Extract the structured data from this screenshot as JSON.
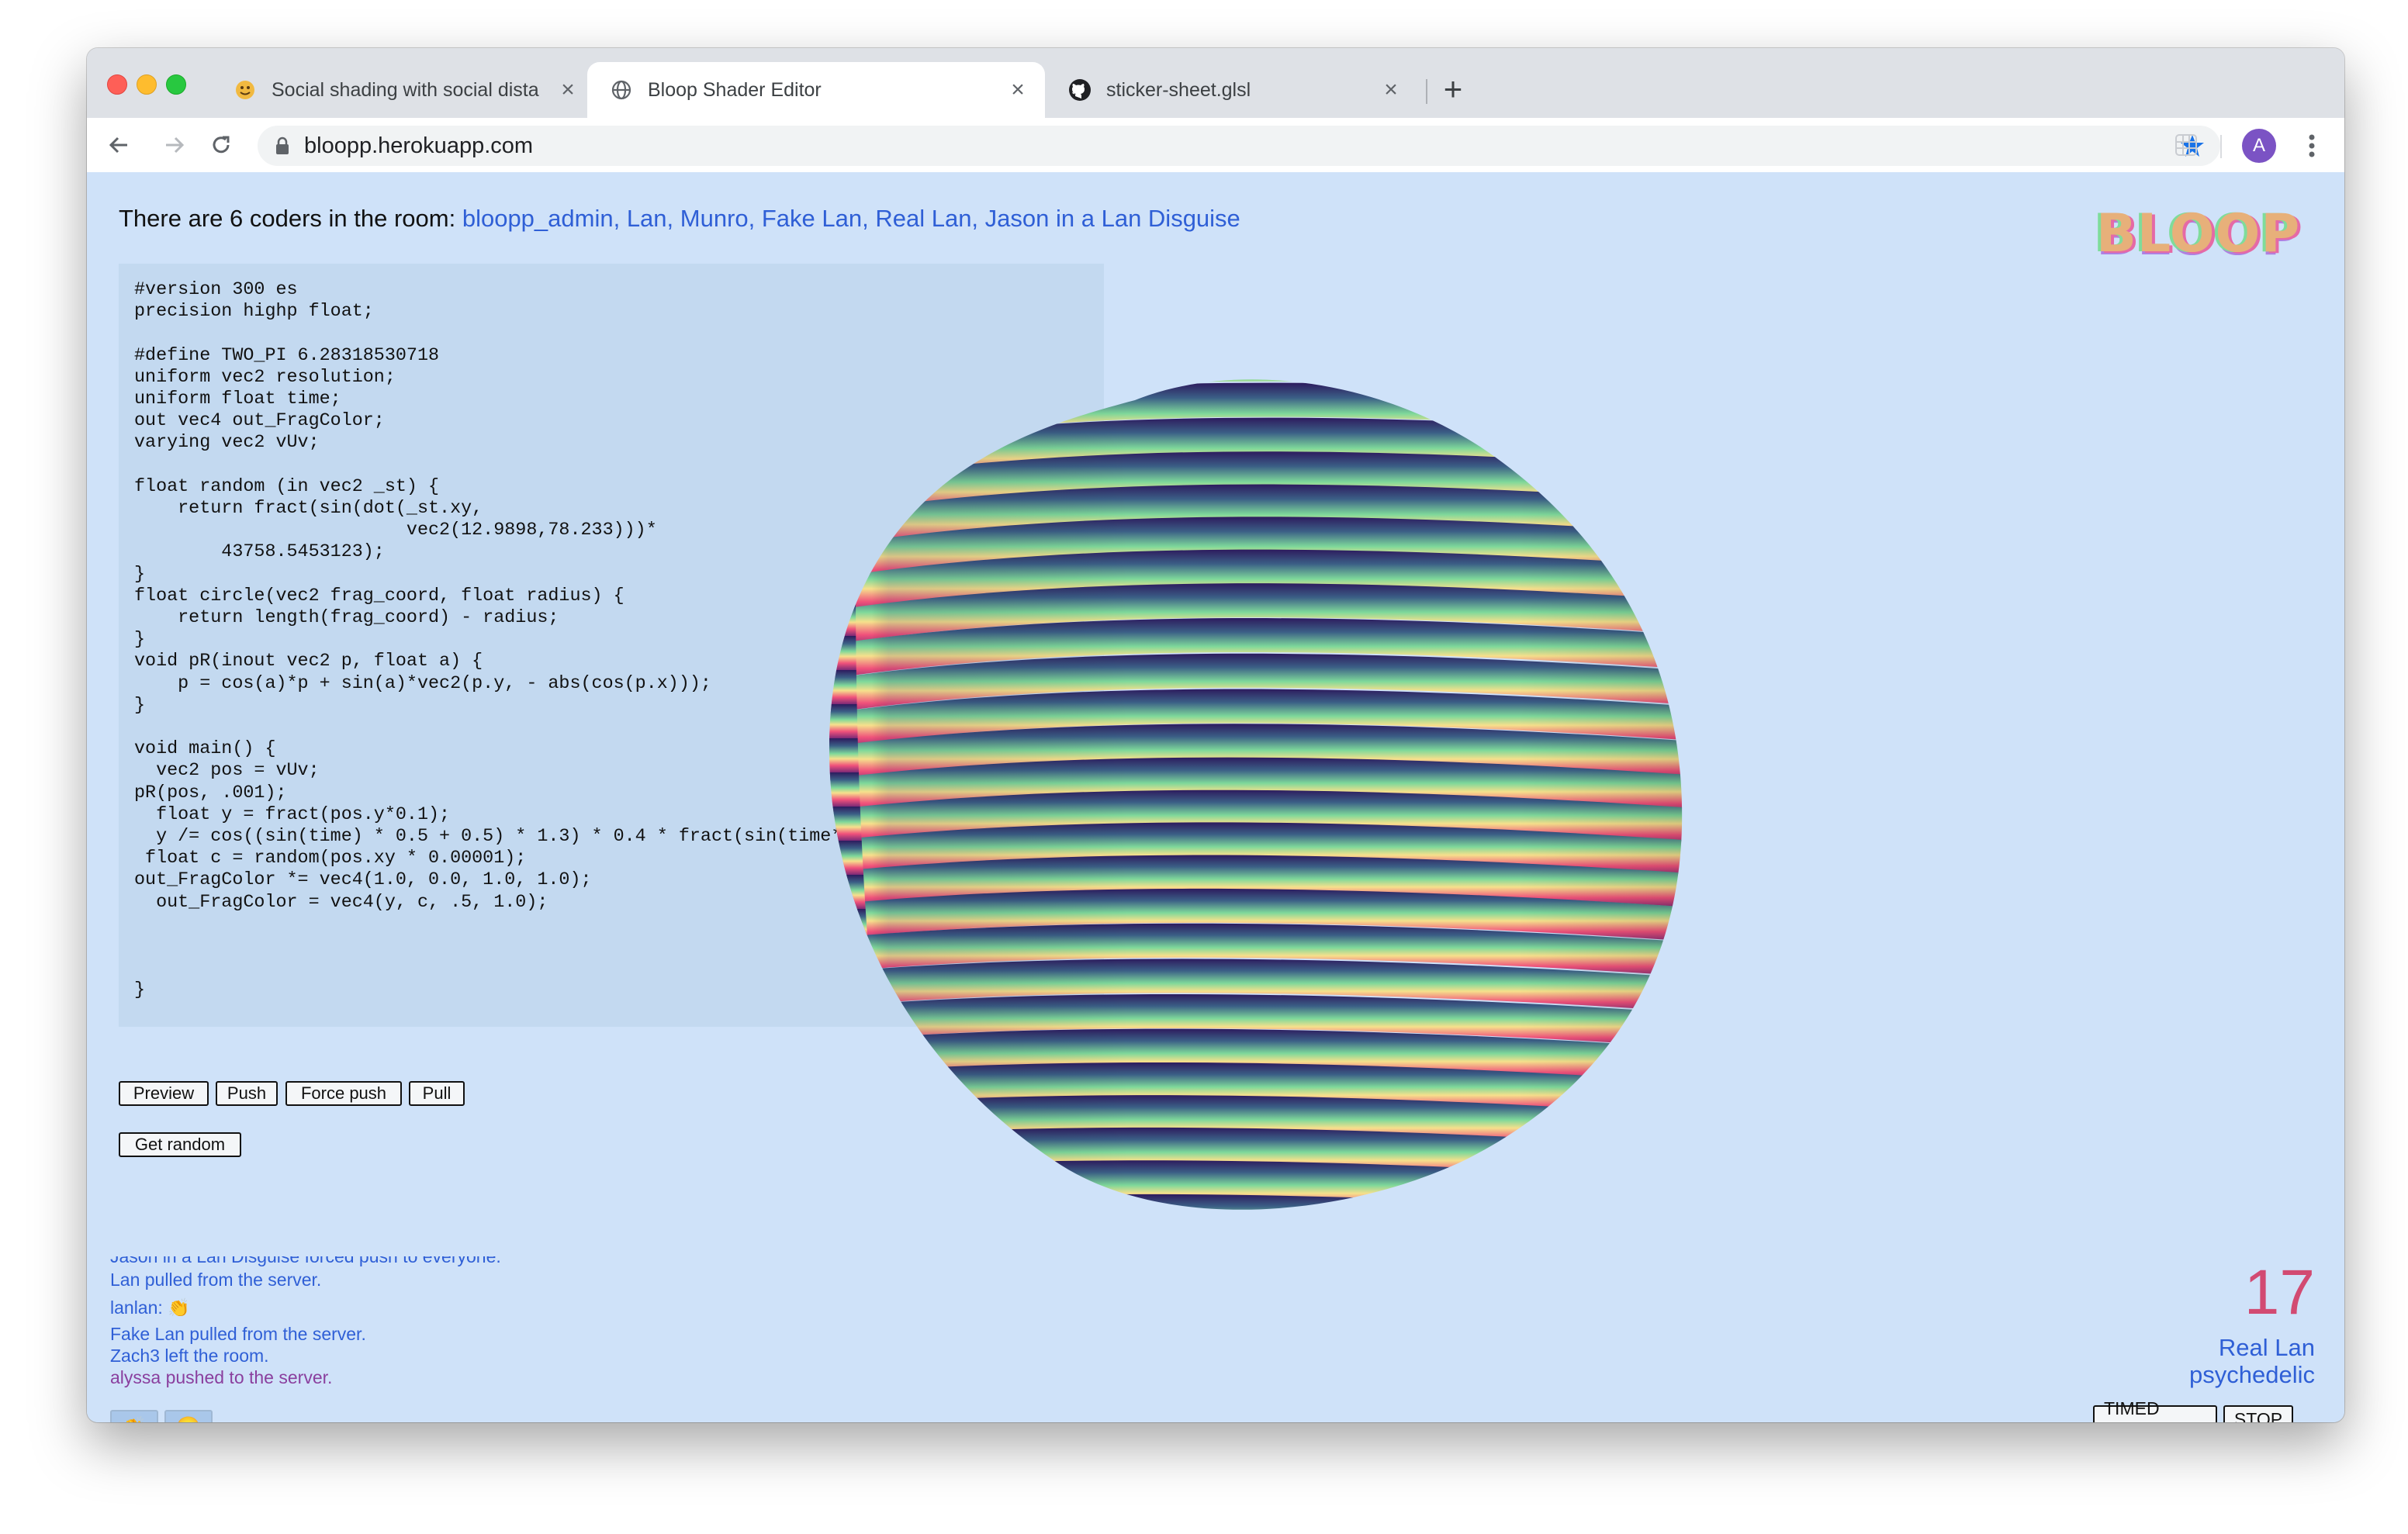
{
  "browser": {
    "tabs": [
      {
        "title": "Social shading with social dista"
      },
      {
        "title": "Bloop Shader Editor"
      },
      {
        "title": "sticker-sheet.glsl"
      }
    ],
    "new_tab_glyph": "+",
    "close_glyph": "×",
    "url": "bloopp.herokuapp.com",
    "profile_initial": "A"
  },
  "room": {
    "prefix": "There are 6 coders in the room: ",
    "names": "bloopp_admin, Lan, Munro, Fake Lan, Real Lan, Jason in a Lan Disguise"
  },
  "logo": "BLOOP",
  "editor": {
    "code": "#version 300 es\nprecision highp float;\n\n#define TWO_PI 6.28318530718\nuniform vec2 resolution;\nuniform float time;\nout vec4 out_FragColor;\nvarying vec2 vUv;\n\nfloat random (in vec2 _st) {\n    return fract(sin(dot(_st.xy,\n                         vec2(12.9898,78.233)))*\n        43758.5453123);\n}\nfloat circle(vec2 frag_coord, float radius) {\n    return length(frag_coord) - radius;\n}\nvoid pR(inout vec2 p, float a) {\n    p = cos(a)*p + sin(a)*vec2(p.y, - abs(cos(p.x)));\n}\n\nvoid main() {\n  vec2 pos = vUv;\npR(pos, .001);\n  float y = fract(pos.y*0.1);\n  y /= cos((sin(time) * 0.5 + 0.5) * 1.3) * 0.4 * fract(sin(time*.3) - pos.x*4.);\n float c = random(pos.xy * 0.00001);\nout_FragColor *= vec4(1.0, 0.0, 1.0, 1.0);\n  out_FragColor = vec4(y, c, .5, 1.0);\n\n\n\n}"
  },
  "controls": {
    "preview": "Preview",
    "push": "Push",
    "force_push": "Force push",
    "pull": "Pull",
    "get_random": "Get random"
  },
  "log": [
    {
      "text": "Jason in a Lan Disguise forced push to everyone.",
      "color": "#2f5fd6"
    },
    {
      "text": "Lan pulled from the server.",
      "color": "#2f5fd6"
    },
    {
      "text": "lanlan: 👏",
      "color": "#2f5fd6"
    },
    {
      "text": "Fake Lan pulled from the server.",
      "color": "#2f5fd6"
    },
    {
      "text": "Zach3 left the room.",
      "color": "#2f5fd6"
    },
    {
      "text": "alyssa pushed to the server.",
      "color": "#8a3f9e"
    }
  ],
  "reactions": [
    "👏",
    "😀"
  ],
  "session": {
    "count": "17",
    "user": "Real Lan",
    "theme": "psychedelic",
    "timed_play": "TIMED PLAY",
    "stop": "STOP"
  },
  "colors": {
    "accent": "#2f5fd6",
    "counter": "#d24a72",
    "page_bg": "#cfe2f9",
    "editor_bg": "#c3d9f0"
  }
}
